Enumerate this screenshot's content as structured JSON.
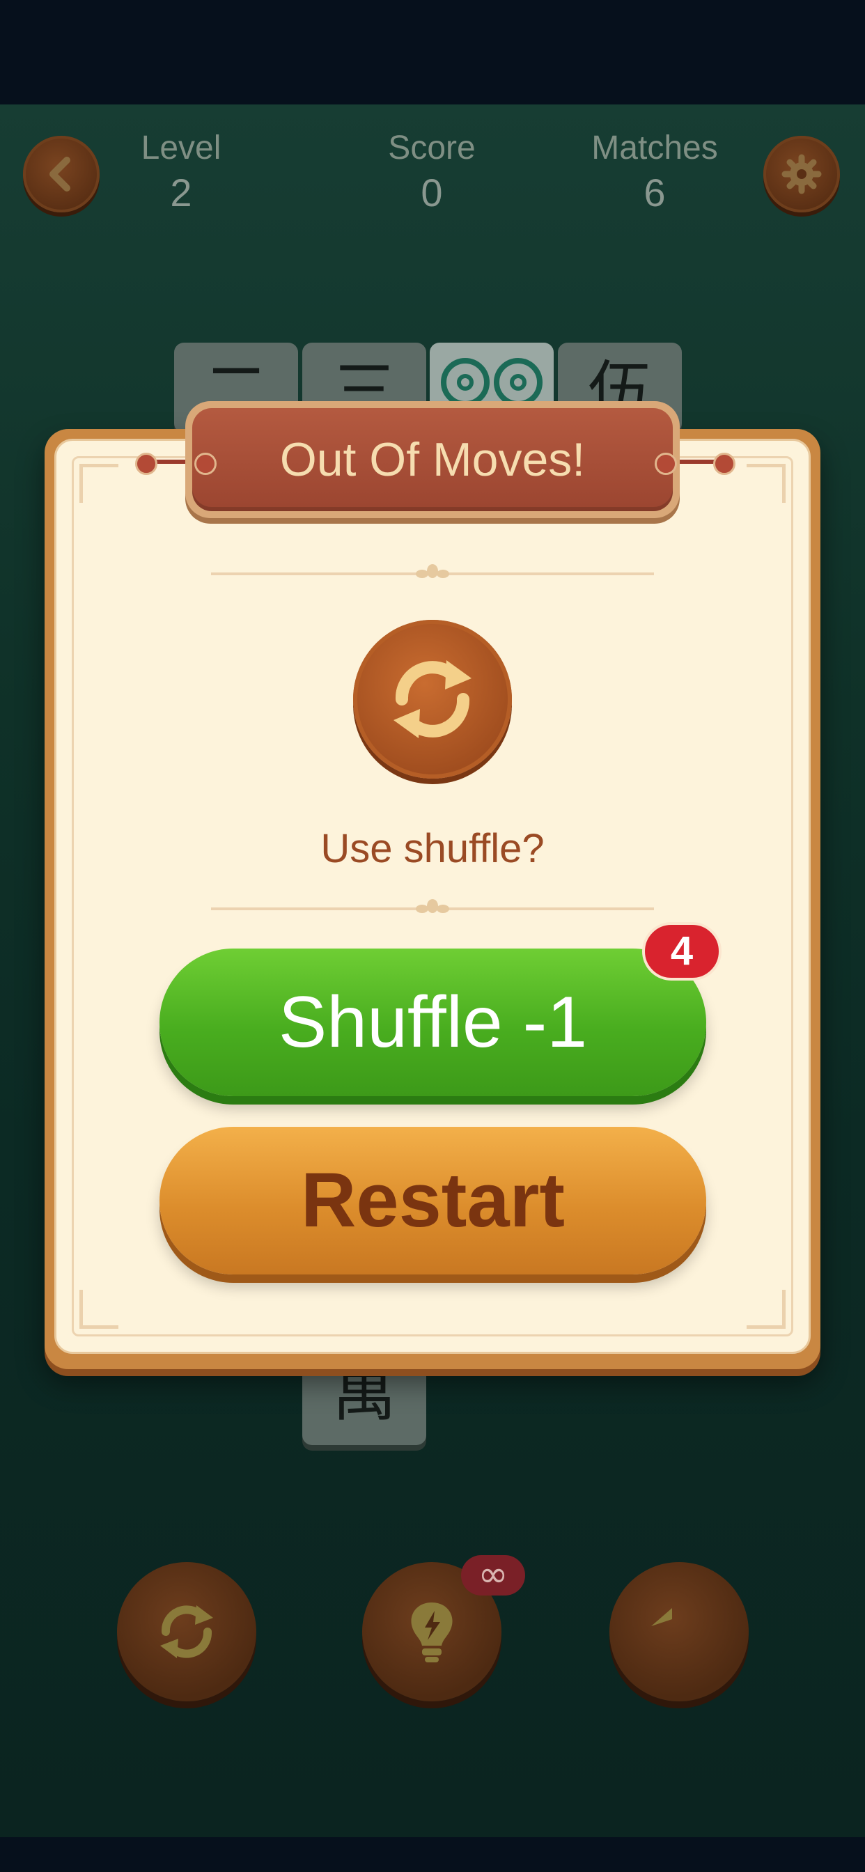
{
  "hud": {
    "level_label": "Level",
    "level_value": "2",
    "score_label": "Score",
    "score_value": "0",
    "matches_label": "Matches",
    "matches_value": "6"
  },
  "board_tiles": [
    "二",
    "三",
    "伍",
    "萬"
  ],
  "dialog": {
    "title": "Out Of Moves!",
    "question": "Use shuffle?",
    "shuffle_button_label": "Shuffle -1",
    "shuffle_count": "4",
    "restart_button_label": "Restart"
  },
  "toolbar": {
    "hint_badge": "∞",
    "icons": [
      "shuffle-icon",
      "lightbulb-icon",
      "undo-icon"
    ]
  },
  "colors": {
    "background": "#0f3128",
    "dialog_frame": "#c98742",
    "dialog_panel": "#fdf3db",
    "title_ribbon": "#b45a40",
    "shuffle_button": "#49ad1f",
    "restart_button": "#dc8d2c",
    "badge_red": "#d9232e"
  }
}
